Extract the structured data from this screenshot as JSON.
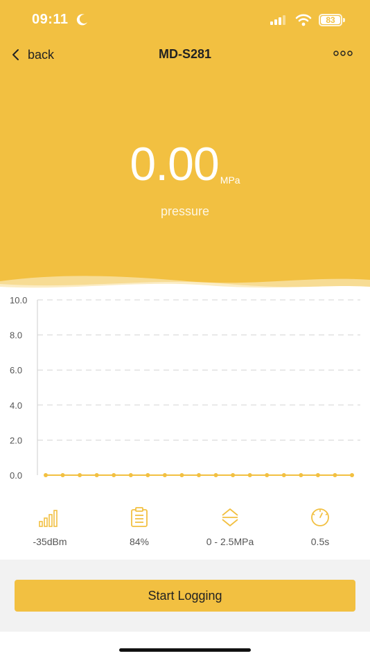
{
  "status_bar": {
    "time": "09:11",
    "battery": "83"
  },
  "nav": {
    "back_label": "back",
    "title": "MD-S281"
  },
  "reading": {
    "value": "0.00",
    "unit": "MPa",
    "label": "pressure"
  },
  "chart_data": {
    "type": "line",
    "title": "",
    "xlabel": "",
    "ylabel": "",
    "ylim": [
      0,
      10
    ],
    "yticks": [
      "10.0",
      "8.0",
      "6.0",
      "4.0",
      "2.0",
      "0.0"
    ],
    "grid": true,
    "series": [
      {
        "values": [
          0,
          0,
          0,
          0,
          0,
          0,
          0,
          0,
          0,
          0,
          0,
          0,
          0,
          0,
          0,
          0,
          0,
          0,
          0
        ]
      }
    ],
    "color": "#f2c041"
  },
  "stats": [
    {
      "icon": "signal-bars-icon",
      "value": "-35dBm"
    },
    {
      "icon": "battery-clipboard-icon",
      "value": "84%"
    },
    {
      "icon": "range-arrows-icon",
      "value": "0 - 2.5MPa"
    },
    {
      "icon": "gauge-icon",
      "value": "0.5s"
    }
  ],
  "action": {
    "start_label": "Start Logging"
  },
  "colors": {
    "accent": "#f2c041",
    "text": "#222222"
  }
}
